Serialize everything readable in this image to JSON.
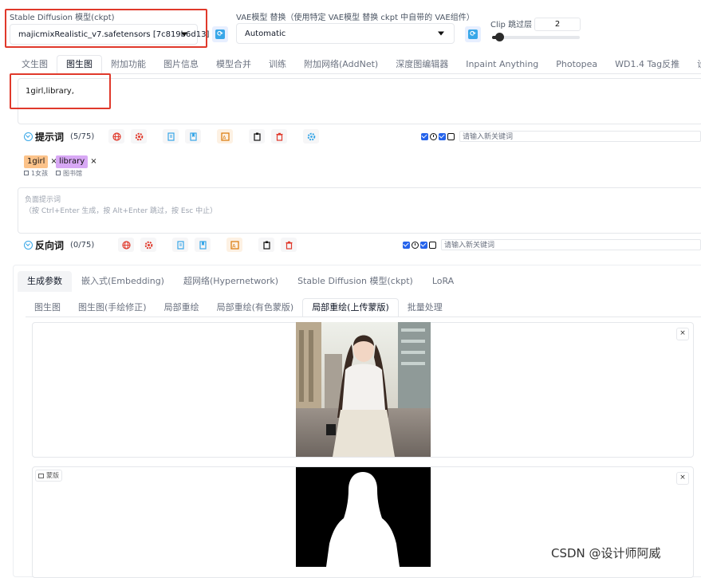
{
  "model": {
    "label": "Stable Diffusion 模型(ckpt)",
    "value": "majicmixRealistic_v7.safetensors [7c819b6d13]"
  },
  "vae": {
    "label": "VAE模型 替换（使用特定 VAE模型 替换 ckpt 中自带的 VAE组件）",
    "value": "Automatic"
  },
  "clip": {
    "label": "Clip 跳过层",
    "value": "2",
    "slider_level": 0.06
  },
  "main_tabs": [
    "文生图",
    "图生图",
    "附加功能",
    "图片信息",
    "模型合并",
    "训练",
    "附加网络(AddNet)",
    "深度图编辑器",
    "Inpaint Anything",
    "Photopea",
    "WD1.4 Tag反推",
    "设"
  ],
  "prompt": {
    "text": "1girl,library,",
    "heading": "提示词",
    "count": "(5/75)",
    "keyword_placeholder": "请输入新关键词",
    "tags": [
      {
        "label": "1girl",
        "sub": "1女孩",
        "color": "#fcc38a"
      },
      {
        "label": "library",
        "sub": "图书馆",
        "color": "#d8a8f5"
      }
    ]
  },
  "negative": {
    "placeholder_line1": "负面提示词",
    "placeholder_line2": "（按 Ctrl+Enter 生成，按 Alt+Enter 跳过，按 Esc 中止）",
    "heading": "反向词",
    "count": "(0/75)",
    "keyword_placeholder": "请输入新关键词"
  },
  "param_tabs": [
    "生成参数",
    "嵌入式(Embedding)",
    "超网络(Hypernetwork)",
    "Stable Diffusion 模型(ckpt)",
    "LoRA"
  ],
  "mode_tabs": [
    "图生图",
    "图生图(手绘修正)",
    "局部重绘",
    "局部重绘(有色蒙版)",
    "局部重绘(上传蒙版)",
    "批量处理"
  ],
  "mask_label": "蒙版",
  "close_glyph": "×",
  "tag_remove_glyph": "×",
  "watermark": "CSDN @设计师阿威",
  "colors": {
    "highlight_box": "#e0392b",
    "accent_blue": "#38a7e8",
    "checkbox_blue": "#2563eb"
  }
}
